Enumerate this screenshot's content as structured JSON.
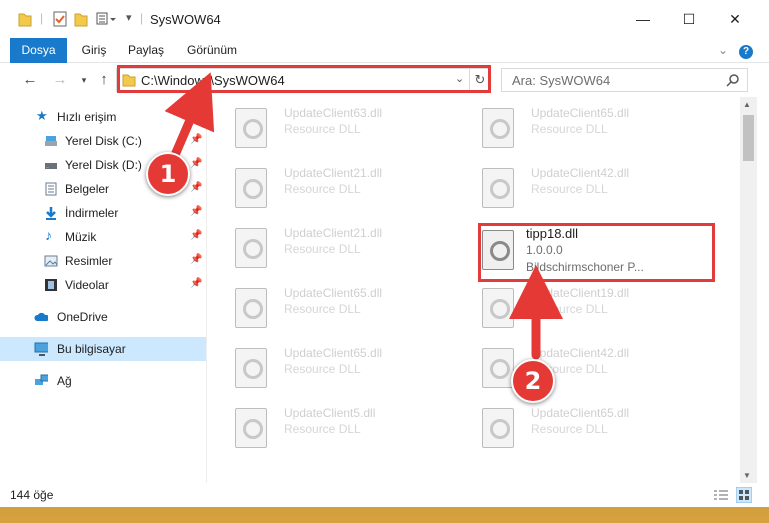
{
  "window": {
    "title": "SysWOW64",
    "controls": {
      "minimize": "—",
      "maximize": "☐",
      "close": "✕"
    }
  },
  "ribbon": {
    "tabs": [
      "Dosya",
      "Giriş",
      "Paylaş",
      "Görünüm"
    ],
    "help": "?"
  },
  "address": {
    "path": "C:\\Windows\\SysWOW64",
    "search_placeholder": "Ara: SysWOW64"
  },
  "nav": {
    "quick_access": "Hızlı erişim",
    "pinned": [
      "Yerel Disk (C:)",
      "Yerel Disk (D:)",
      "Belgeler",
      "İndirmeler",
      "Müzik",
      "Resimler",
      "Videolar"
    ],
    "onedrive": "OneDrive",
    "this_pc": "Bu bilgisayar",
    "network": "Ağ"
  },
  "files": [
    {
      "name": "UpdateClient63.dll",
      "desc": "Resource DLL"
    },
    {
      "name": "UpdateClient65.dll",
      "desc": "Resource DLL"
    },
    {
      "name": "UpdateClient21.dll",
      "desc": "Resource DLL"
    },
    {
      "name": "UpdateClient42.dll",
      "desc": "Resource DLL"
    },
    {
      "name": "UpdateClient21.dll",
      "desc": "Resource DLL"
    },
    {
      "name": "tipp18.dll",
      "version": "1.0.0.0",
      "desc": "Bildschirmschoner P..."
    },
    {
      "name": "UpdateClient65.dll",
      "desc": "Resource DLL"
    },
    {
      "name": "UpdateClient19.dll",
      "desc": "Resource DLL"
    },
    {
      "name": "UpdateClient65.dll",
      "desc": "Resource DLL"
    },
    {
      "name": "UpdateClient42.dll",
      "desc": "Resource DLL"
    },
    {
      "name": "UpdateClient5.dll",
      "desc": "Resource DLL"
    },
    {
      "name": "UpdateClient65.dll",
      "desc": "Resource DLL"
    }
  ],
  "status": {
    "item_count": "144 öğe"
  },
  "annotations": {
    "step1": "1",
    "step2": "2",
    "color": "#e53935"
  }
}
